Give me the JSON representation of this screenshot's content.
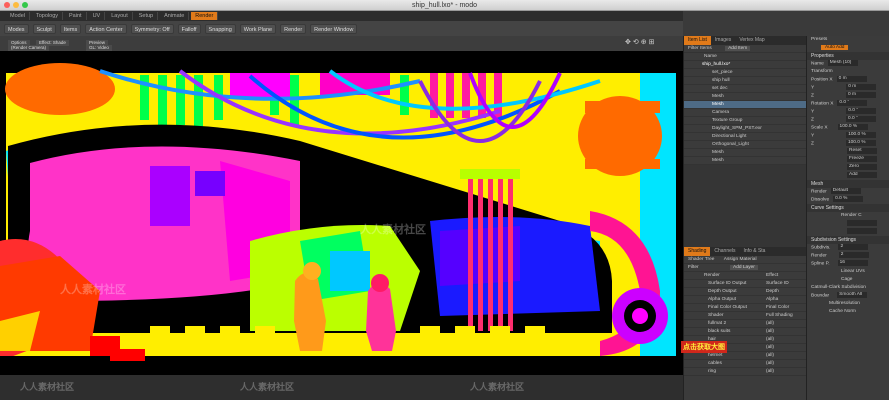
{
  "window": {
    "title": "ship_hull.lxo* - modo"
  },
  "menu_tabs": [
    "Model",
    "Topology",
    "Paint",
    "UV",
    "Layout",
    "Setup",
    "Animate",
    "Render"
  ],
  "active_tab": "Render",
  "toolbar": {
    "mode": "Modes",
    "sculpt": "Sculpt",
    "items": "Items",
    "action_center": "Action Center",
    "symmetry": "Symmetry: Off",
    "falloff": "Falloff",
    "snapping": "Snapping",
    "work_plane": "Work Plane",
    "render": "Render",
    "render_window": "Render Window"
  },
  "viewport": {
    "options": "Options",
    "effect": "Effect: Shade",
    "preview": "Preview",
    "render_camera": "(Render Camera)",
    "gl_vbo": "GL: Video"
  },
  "item_list": {
    "tabs": [
      "Item List",
      "Images",
      "Vertex Map"
    ],
    "filter": "Filter Items",
    "add_item": "Add Item",
    "rows": [
      "Name",
      "ship_hull.lxo*",
      "set_piece",
      "ship hull",
      "set dec",
      "Mesh",
      "Mesh",
      "Camera",
      "Texture Group",
      "Daylight_SPM_PST.exr",
      "Directional Light",
      "Orthogonal_Light",
      "Mesh",
      "Mesh"
    ],
    "selected_index": 5
  },
  "shading": {
    "tabs": [
      "Shading",
      "Channels",
      "Info & Sta"
    ],
    "view": "Shader Tree",
    "assign": "Assign Material",
    "filter": "Filter",
    "add_layer": "Add Layer",
    "rows": [
      {
        "name": "Render",
        "effect": "Effect"
      },
      {
        "name": "Surface ID Output",
        "effect": "Surface ID"
      },
      {
        "name": "Depth Output",
        "effect": "Depth"
      },
      {
        "name": "Alpha Output",
        "effect": "Alpha"
      },
      {
        "name": "Final Color Output",
        "effect": "Final Color"
      },
      {
        "name": "Shader",
        "effect": "Full Shading"
      },
      {
        "name": "fullmat 2",
        "effect": "(all)"
      },
      {
        "name": "black suits",
        "effect": "(all)"
      },
      {
        "name": "hair",
        "effect": "(all)"
      },
      {
        "name": "shell p",
        "effect": "(all)"
      },
      {
        "name": "helmet",
        "effect": "(all)"
      },
      {
        "name": "cables",
        "effect": "(all)"
      },
      {
        "name": "ring",
        "effect": "(all)"
      }
    ]
  },
  "properties": {
    "presets": "Presets",
    "auto_add": "Auto Add",
    "tab": "Properties",
    "name_label": "Name",
    "name_value": "Mesh (10)",
    "transform": "Transform",
    "position": [
      "0 m",
      "0 m",
      "0 m"
    ],
    "rotation": [
      "0.0 °",
      "0.0 °",
      "0.0 °"
    ],
    "scale": [
      "100.0 %",
      "100.0 %",
      "100.0 %"
    ],
    "reset": "Reset",
    "freeze": "Freeze",
    "zero": "Zero",
    "add": "Add",
    "mesh": "Mesh",
    "render": "Render",
    "render_value": "Default",
    "dissolve": "Dissolve",
    "dissolve_value": "0.0 %",
    "curve_settings": "Curve Settings",
    "render_curves": "Render C",
    "subdiv_settings": "Subdivision Settings",
    "subdiv_level": "2",
    "render_level": "2",
    "spline_patch": "16",
    "linear_uvs": "Linear UVs",
    "cage": "Cage",
    "catmull_clark": "Catmull-Clark Subdivision",
    "boundary": "Smooth All",
    "multiresolution": "Multiresolution",
    "cache_normals": "Cache Norm"
  },
  "watermark": "人人素材社区",
  "stamp": "点击获取大图"
}
